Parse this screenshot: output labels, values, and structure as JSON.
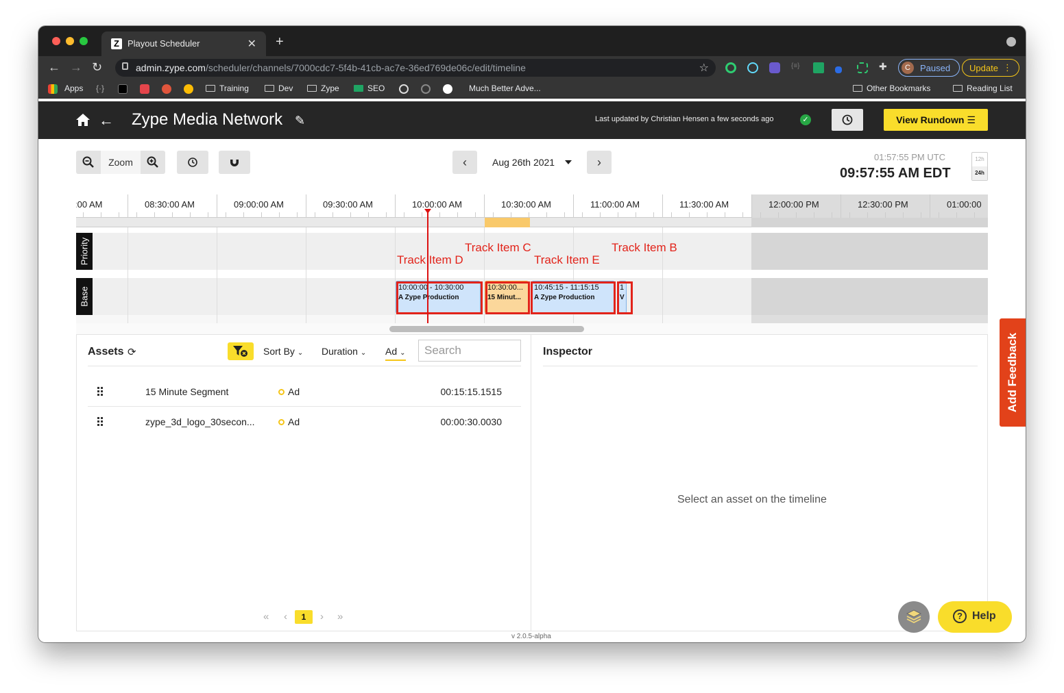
{
  "browser": {
    "tab_title": "Playout Scheduler",
    "url_host": "admin.zype.com",
    "url_path": "/scheduler/channels/7000cdc7-5f4b-41cb-ac7e-36ed769de06c/edit/timeline",
    "profile_initial": "C",
    "profile_status": "Paused",
    "update_label": "Update",
    "bookmarks": [
      "Apps",
      "Training",
      "Dev",
      "Zype",
      "SEO",
      "Much Better Adve...",
      "Other Bookmarks",
      "Reading List"
    ]
  },
  "header": {
    "channel_name": "Zype Media Network",
    "last_updated": "Last updated by Christian Hensen a few seconds ago",
    "view_rundown_label": "View Rundown"
  },
  "toolbar": {
    "zoom_label": "Zoom",
    "date": "Aug 26th 2021",
    "utc_time": "01:57:55 PM UTC",
    "local_time": "09:57:55 AM EDT",
    "hour_12": "12h",
    "hour_24": "24h"
  },
  "timeline": {
    "ticks": [
      ":00 AM",
      "08:30:00 AM",
      "09:00:00 AM",
      "09:30:00 AM",
      "10:00:00 AM",
      "10:30:00 AM",
      "11:00:00 AM",
      "11:30:00 AM",
      "12:00:00 PM",
      "12:30:00 PM",
      "01:00:00"
    ],
    "rows": [
      "Priority",
      "Base"
    ],
    "tracks": [
      {
        "time": "10:00:00 - 10:30:00",
        "name": "A Zype Production"
      },
      {
        "time": "10:30:00...",
        "name": "15 Minut..."
      },
      {
        "time": "10:45:15 - 11:15:15",
        "name": "A Zype Production"
      },
      {
        "time": "1",
        "name": "V"
      }
    ],
    "annotations": [
      "Track Item D",
      "Track Item C",
      "Track Item E",
      "Track Item B"
    ]
  },
  "assets": {
    "title": "Assets",
    "sort_by": "Sort By",
    "duration": "Duration",
    "type_filter": "Ad",
    "search_placeholder": "Search",
    "items": [
      {
        "name": "15 Minute Segment",
        "type": "Ad",
        "duration": "00:15:15.1515"
      },
      {
        "name": "zype_3d_logo_30secon...",
        "type": "Ad",
        "duration": "00:00:30.0030"
      }
    ],
    "pager": {
      "first": "«",
      "prev": "‹",
      "current": "1",
      "next": "›",
      "last": "»"
    }
  },
  "inspector": {
    "title": "Inspector",
    "empty_text": "Select an asset on the timeline"
  },
  "footer": {
    "version": "v 2.0.5-alpha",
    "feedback_label": "Add Feedback",
    "help_label": "Help",
    "help_glyph": "?"
  }
}
